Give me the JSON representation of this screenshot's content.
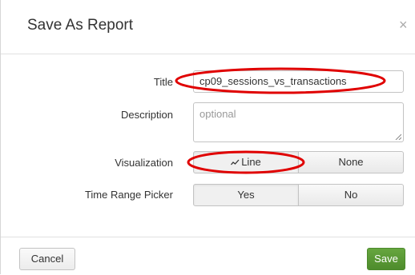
{
  "dialog": {
    "title": "Save As Report",
    "close_glyph": "×",
    "close_icon": "close-icon"
  },
  "form": {
    "title_label": "Title",
    "title_value": "cp09_sessions_vs_transactions",
    "description_label": "Description",
    "description_placeholder": "optional",
    "visualization_label": "Visualization",
    "visualization_options": [
      {
        "label": "Line",
        "icon": "line-chart-icon",
        "selected": true
      },
      {
        "label": "None",
        "selected": false
      }
    ],
    "time_range_label": "Time Range Picker",
    "time_range_options": [
      {
        "label": "Yes",
        "selected": true
      },
      {
        "label": "No",
        "selected": false
      }
    ]
  },
  "footer": {
    "cancel_label": "Cancel",
    "save_label": "Save"
  },
  "colors": {
    "annotation": "#e00000",
    "save_button": "#5a9b35"
  }
}
